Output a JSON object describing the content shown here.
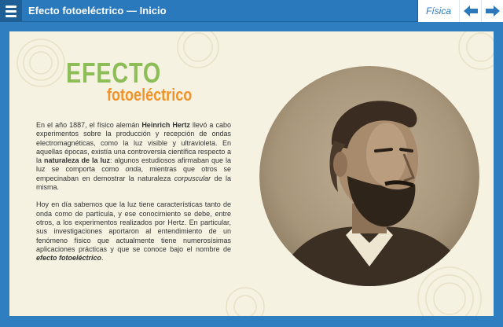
{
  "header": {
    "title": "Efecto fotoeléctrico  —  Inicio",
    "subject": "Física",
    "menu_icon": "menu-icon",
    "prev_icon": "arrow-left-icon",
    "next_icon": "arrow-right-icon"
  },
  "content": {
    "title_main": "EFECTO",
    "title_sub": "fotoeléctrico",
    "p1_a": "En el año 1887, el físico alemán ",
    "p1_b": "Heinrich Hertz",
    "p1_c": " llevó a cabo experimentos sobre la producción y recepción de ondas electromagnéticas, como la luz visible y ultravioleta. En aquellas épocas, existía una controversia científica respecto a la ",
    "p1_d": "naturaleza de la luz",
    "p1_e": ": algunos estudiosos afirmaban que la luz se comporta como ",
    "p1_f": "onda",
    "p1_g": ", mientras que otros se empecinaban en demostrar la naturaleza ",
    "p1_h": "corpuscular",
    "p1_i": " de la misma.",
    "p2_a": "Hoy en día sabemos que la luz tiene características tanto de onda como de partícula, y ese conocimiento se debe, entre otros, a los experimentos realizados por Hertz. En particular, sus investigaciones aportaron al entendimiento de un fenómeno físico que actualmente tiene numerosísimas aplicaciones prácticas y que se conoce bajo el nombre de ",
    "p2_b": "efecto fotoeléctrico",
    "p2_c": "."
  },
  "colors": {
    "header_bg": "#2b79bd",
    "title_green": "#8cbd56",
    "title_orange": "#f0932b",
    "card_bg": "#f5f2e2",
    "portrait_tone": "#6b5a46"
  }
}
